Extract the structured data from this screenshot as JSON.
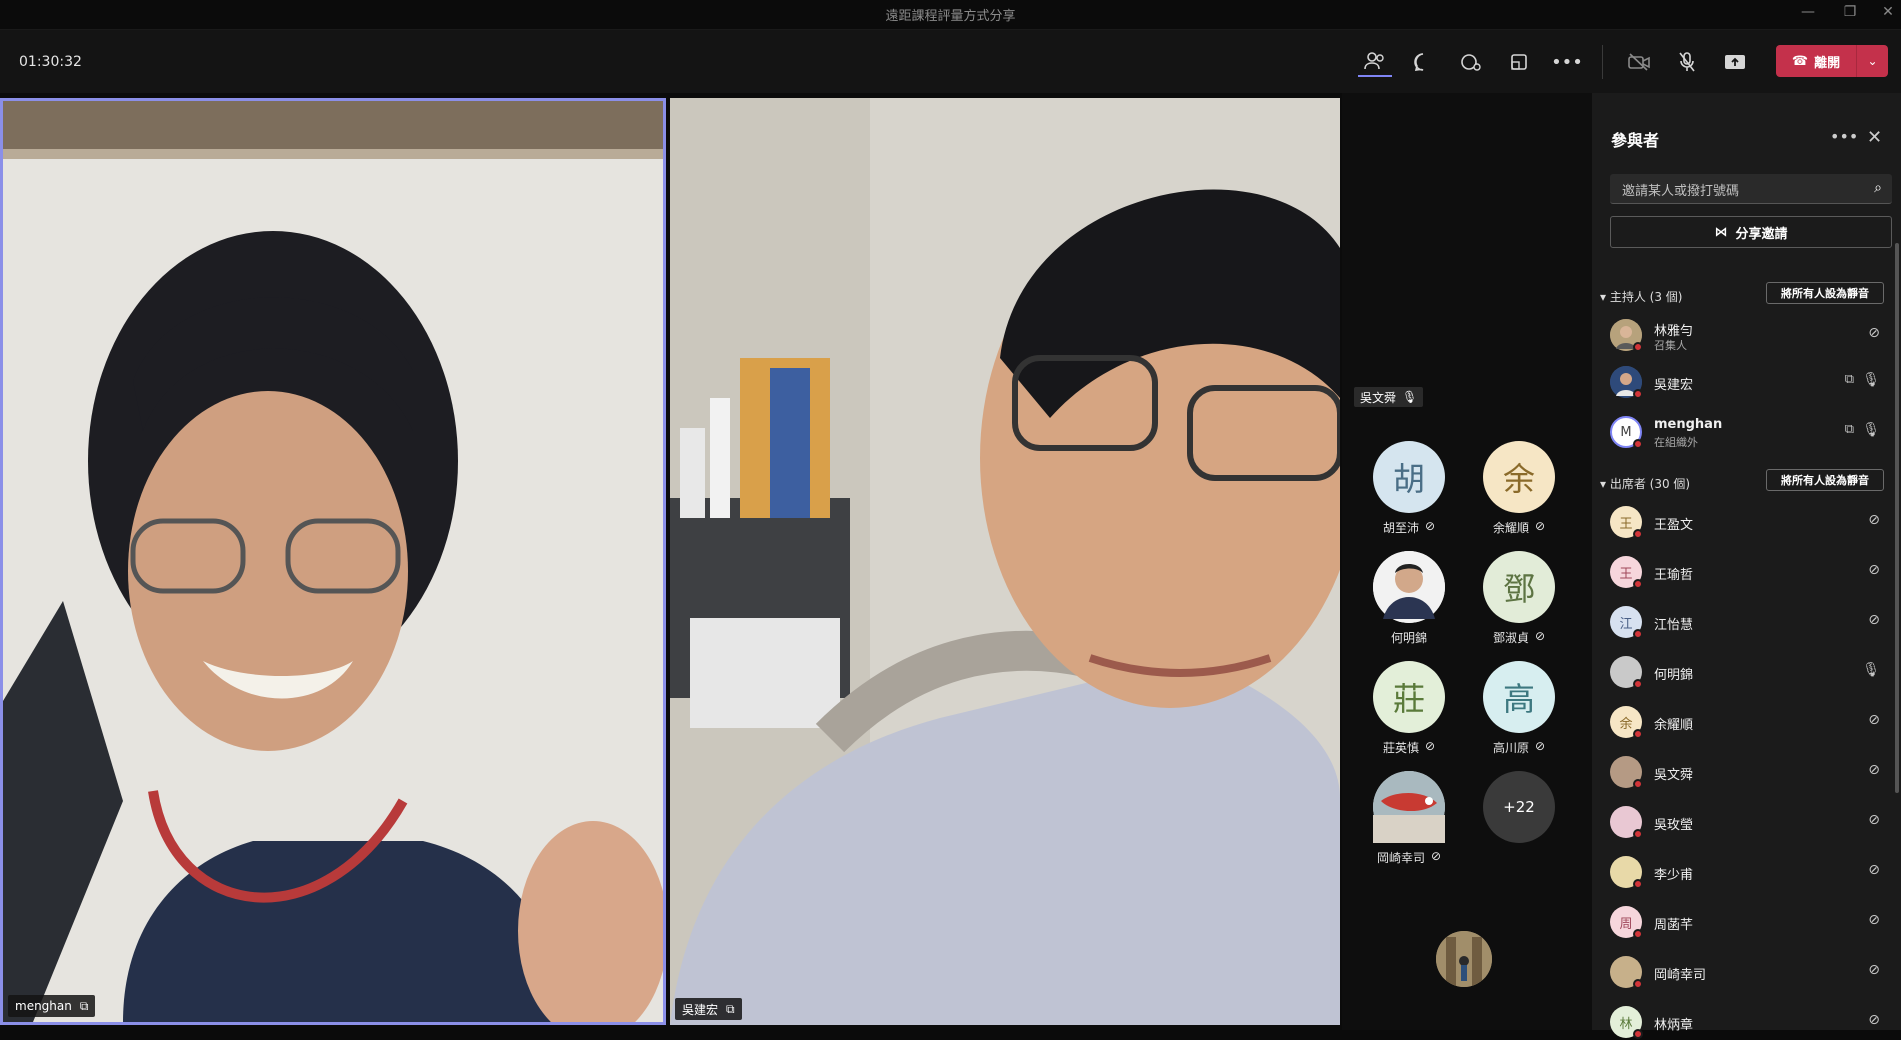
{
  "window": {
    "title": "遠距課程評量方式分享"
  },
  "toolbar": {
    "timer": "01:30:32",
    "leave_label": "離開"
  },
  "stage": {
    "main_videos": [
      {
        "name": "menghan"
      },
      {
        "name": "吳建宏"
      }
    ],
    "spotlight_label": "吳文舜",
    "tiles": [
      {
        "initial": "胡",
        "name": "胡至沛",
        "bg": "#d5e5ef",
        "fg": "#4a6e86"
      },
      {
        "initial": "余",
        "name": "余耀順",
        "bg": "#f6e6c5",
        "fg": "#8a6a2a"
      },
      {
        "initial": "",
        "name": "何明錦",
        "bg": "#e9e9e9",
        "fg": "#333"
      },
      {
        "initial": "鄧",
        "name": "鄧淑貞",
        "bg": "#e2ecd8",
        "fg": "#5d7443"
      },
      {
        "initial": "莊",
        "name": "莊英慎",
        "bg": "#e3efd9",
        "fg": "#5a7a3a"
      },
      {
        "initial": "高",
        "name": "高川原",
        "bg": "#d7eef0",
        "fg": "#3d7880"
      },
      {
        "initial": "",
        "name": "岡崎幸司",
        "bg": "#c7d3d8",
        "fg": "#333"
      },
      {
        "initial": "+22",
        "name": "",
        "bg": "#3a3a3a",
        "fg": "#ffffff"
      }
    ]
  },
  "panel": {
    "title": "參與者",
    "search_placeholder": "邀請某人或撥打號碼",
    "share_label": "分享邀請",
    "hosts_label": "主持人 (3 個)",
    "attendees_label": "出席者 (30 個)",
    "mute_all_label": "將所有人設為靜音",
    "hosts": [
      {
        "initial": "",
        "name": "林雅勻",
        "sub": "召集人",
        "bg": "#8b7a5e"
      },
      {
        "initial": "",
        "name": "吳建宏",
        "sub": "",
        "bg": "#3a4f75"
      },
      {
        "initial": "M",
        "name": "menghan",
        "sub": "在組織外",
        "bg": "#ffffff"
      }
    ],
    "attendees": [
      {
        "initial": "王",
        "name": "王盈文",
        "bg": "#f6e6c5",
        "fg": "#8a6a2a"
      },
      {
        "initial": "王",
        "name": "王瑜哲",
        "bg": "#f6d6dc",
        "fg": "#a0485a"
      },
      {
        "initial": "江",
        "name": "江怡慧",
        "bg": "#d7e1f0",
        "fg": "#4a5f86"
      },
      {
        "initial": "",
        "name": "何明錦",
        "bg": "#c9c9c9",
        "fg": "#333"
      },
      {
        "initial": "余",
        "name": "余耀順",
        "bg": "#f6e6c5",
        "fg": "#8a6a2a"
      },
      {
        "initial": "",
        "name": "吳文舜",
        "bg": "#b59a84",
        "fg": "#333"
      },
      {
        "initial": "",
        "name": "吳玫瑩",
        "bg": "#e9c8d3",
        "fg": "#333"
      },
      {
        "initial": "",
        "name": "李少甫",
        "bg": "#e8d9a8",
        "fg": "#333"
      },
      {
        "initial": "周",
        "name": "周菡芊",
        "bg": "#f6d6dc",
        "fg": "#a0485a"
      },
      {
        "initial": "",
        "name": "岡崎幸司",
        "bg": "#c7b08a",
        "fg": "#333"
      },
      {
        "initial": "林",
        "name": "林炳章",
        "bg": "#e3efd9",
        "fg": "#5a7a3a"
      }
    ]
  }
}
